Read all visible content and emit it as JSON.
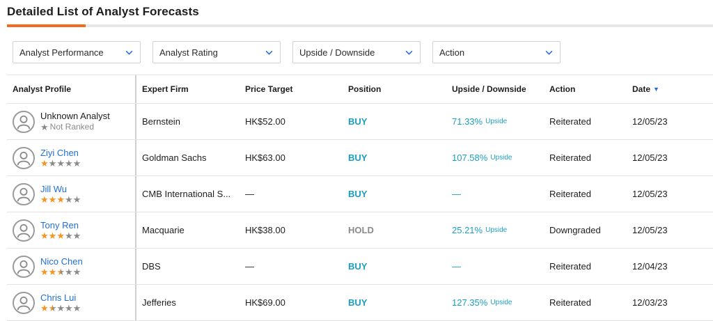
{
  "header": {
    "title": "Detailed List of Analyst Forecasts"
  },
  "filters": [
    {
      "label": "Analyst Performance"
    },
    {
      "label": "Analyst Rating"
    },
    {
      "label": "Upside / Downside"
    },
    {
      "label": "Action"
    }
  ],
  "columns": [
    "Analyst Profile",
    "Expert Firm",
    "Price Target",
    "Position",
    "Upside / Downside",
    "Action",
    "Date"
  ],
  "rows": [
    {
      "name": "Unknown Analyst",
      "rank_text": "Not Ranked",
      "stars": 0,
      "firm": "Bernstein",
      "price_target": "HK$52.00",
      "position": "BUY",
      "upside": "71.33%",
      "upside_label": "Upside",
      "action": "Reiterated",
      "date": "12/05/23"
    },
    {
      "name": "Ziyi Chen",
      "rank_text": "",
      "stars": 1,
      "firm": "Goldman Sachs",
      "price_target": "HK$63.00",
      "position": "BUY",
      "upside": "107.58%",
      "upside_label": "Upside",
      "action": "Reiterated",
      "date": "12/05/23"
    },
    {
      "name": "Jill Wu",
      "rank_text": "",
      "stars": 3,
      "firm": "CMB International S...",
      "price_target": "—",
      "position": "BUY",
      "upside": "—",
      "upside_label": "",
      "action": "Reiterated",
      "date": "12/05/23"
    },
    {
      "name": "Tony Ren",
      "rank_text": "",
      "stars": 3,
      "firm": "Macquarie",
      "price_target": "HK$38.00",
      "position": "HOLD",
      "upside": "25.21%",
      "upside_label": "Upside",
      "action": "Downgraded",
      "date": "12/05/23"
    },
    {
      "name": "Nico Chen",
      "rank_text": "",
      "stars": 2.5,
      "firm": "DBS",
      "price_target": "—",
      "position": "BUY",
      "upside": "—",
      "upside_label": "",
      "action": "Reiterated",
      "date": "12/04/23"
    },
    {
      "name": "Chris Lui",
      "rank_text": "",
      "stars": 1.5,
      "firm": "Jefferies",
      "price_target": "HK$69.00",
      "position": "BUY",
      "upside": "127.35%",
      "upside_label": "Upside",
      "action": "Reiterated",
      "date": "12/03/23"
    }
  ],
  "colors": {
    "accent": "#f26b21",
    "link": "#1f6fd6",
    "buy": "#1a9fc0",
    "hold": "#8a8a8a",
    "star_on": "#f7931e"
  },
  "icons": {
    "filter": "chevron-down-icon",
    "avatar": "user-avatar-icon",
    "sort": "sort-desc-icon"
  }
}
